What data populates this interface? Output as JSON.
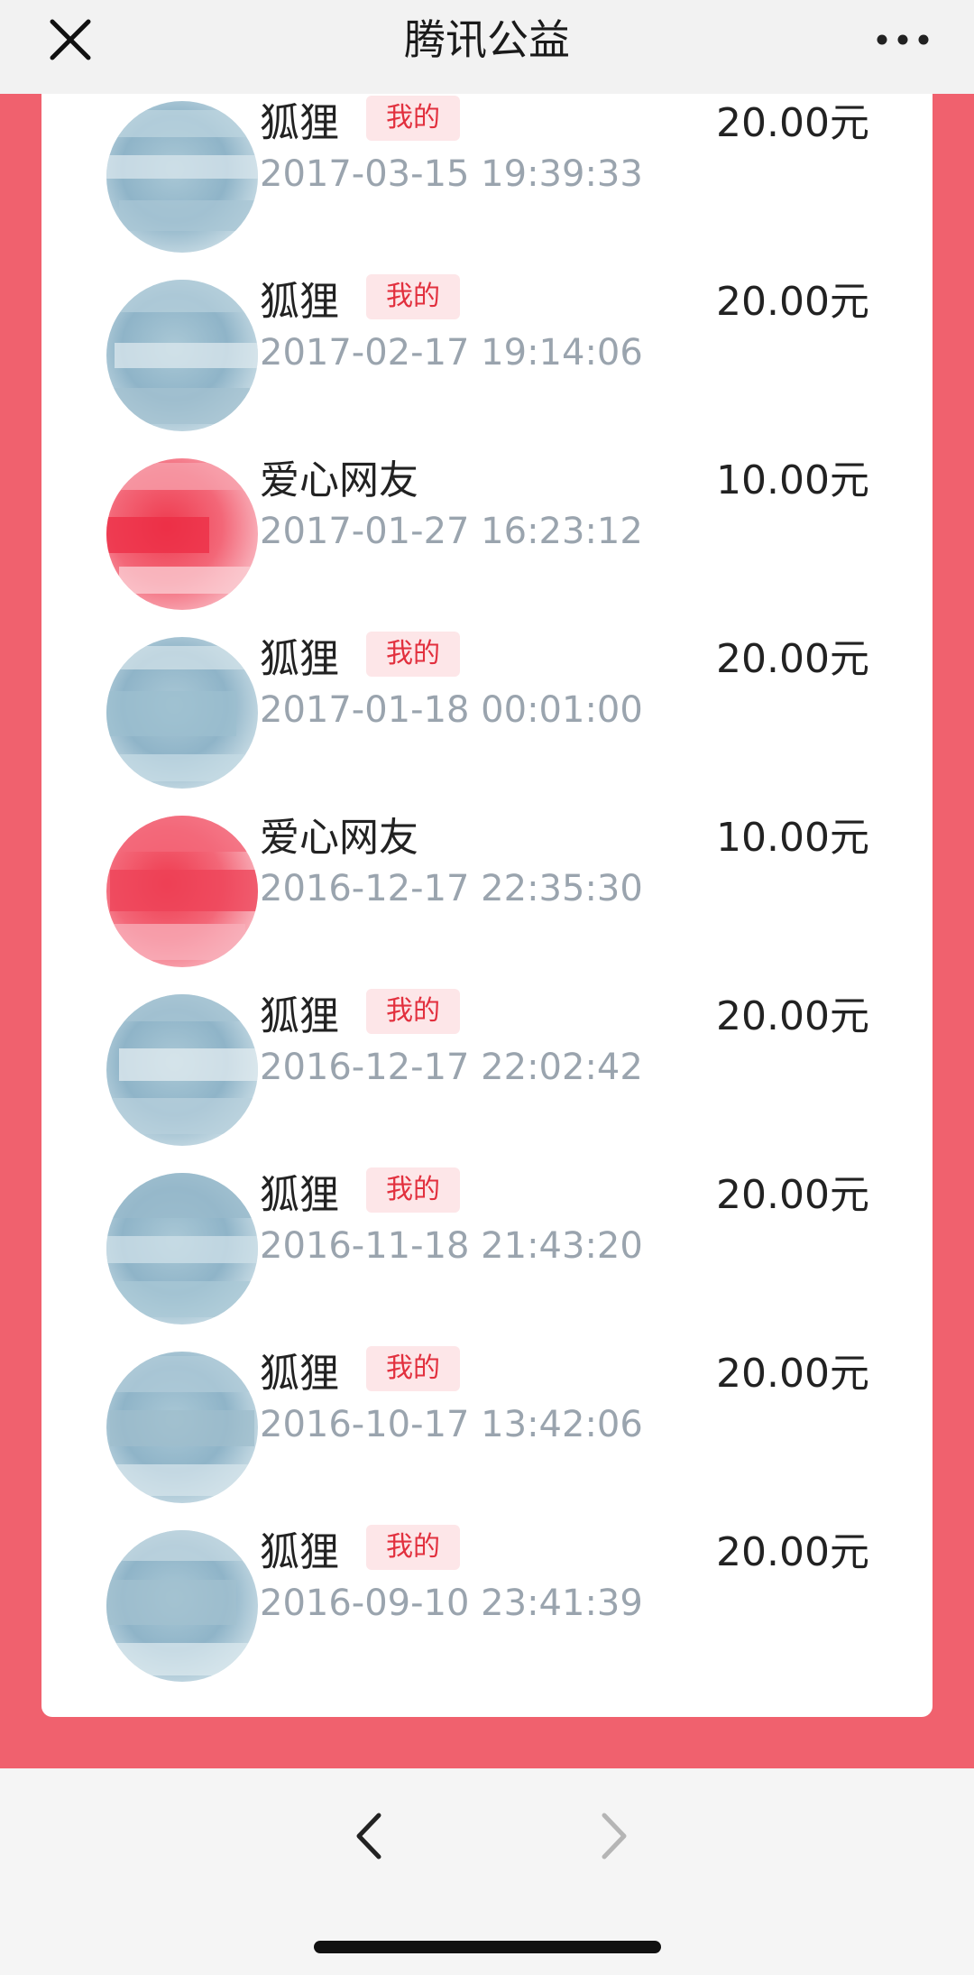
{
  "header": {
    "title": "腾讯公益",
    "close_icon": "close-icon",
    "more_icon": "more-icon"
  },
  "donations": [
    {
      "name": "狐狸",
      "tag": "我的",
      "amount": "20.00元",
      "time": "2017-03-15 19:39:33",
      "avatar": "blue"
    },
    {
      "name": "狐狸",
      "tag": "我的",
      "amount": "20.00元",
      "time": "2017-02-17 19:14:06",
      "avatar": "blue"
    },
    {
      "name": "爱心网友",
      "tag": "",
      "amount": "10.00元",
      "time": "2017-01-27 16:23:12",
      "avatar": "red"
    },
    {
      "name": "狐狸",
      "tag": "我的",
      "amount": "20.00元",
      "time": "2017-01-18 00:01:00",
      "avatar": "blue"
    },
    {
      "name": "爱心网友",
      "tag": "",
      "amount": "10.00元",
      "time": "2016-12-17 22:35:30",
      "avatar": "red"
    },
    {
      "name": "狐狸",
      "tag": "我的",
      "amount": "20.00元",
      "time": "2016-12-17 22:02:42",
      "avatar": "blue"
    },
    {
      "name": "狐狸",
      "tag": "我的",
      "amount": "20.00元",
      "time": "2016-11-18 21:43:20",
      "avatar": "blue"
    },
    {
      "name": "狐狸",
      "tag": "我的",
      "amount": "20.00元",
      "time": "2016-10-17 13:42:06",
      "avatar": "blue"
    },
    {
      "name": "狐狸",
      "tag": "我的",
      "amount": "20.00元",
      "time": "2016-09-10 23:41:39",
      "avatar": "blue"
    }
  ],
  "colors": {
    "background": "#f0616e",
    "tag_text": "#e2303e",
    "tag_bg": "#fde6e8",
    "time_text": "#9aa4ae"
  },
  "footer": {
    "back_icon": "chevron-left-icon",
    "forward_icon": "chevron-right-icon",
    "forward_enabled": false
  }
}
